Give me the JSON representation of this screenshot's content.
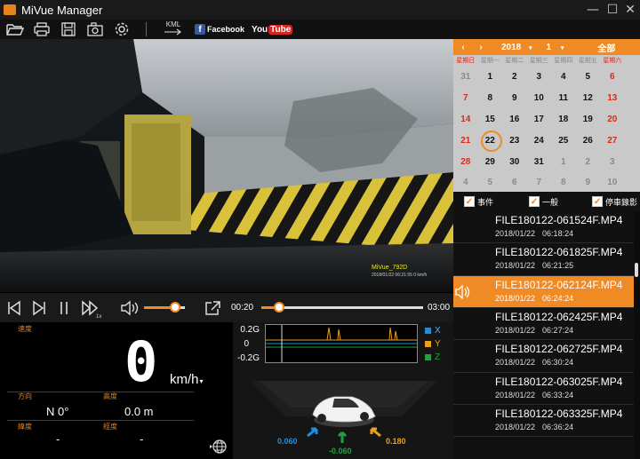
{
  "window": {
    "title": "MiVue Manager"
  },
  "toolbar": {
    "open_icon": "folder-open-icon",
    "print_icon": "printer-icon",
    "save_icon": "save-icon",
    "snapshot_icon": "camera-icon",
    "settings_icon": "gear-icon",
    "kml_label": "KML",
    "facebook_label": "Facebook",
    "facebook_logo": "f",
    "youtube_you": "You",
    "youtube_tube": "Tube"
  },
  "video": {
    "overlay_model": "MiVue_792D",
    "overlay_info": "2018/01/22 06:21:55  0 km/h"
  },
  "playback": {
    "current_time": "00:20",
    "total_time": "03:00",
    "progress": 0.11,
    "volume": 0.75,
    "speed_label": "1x"
  },
  "dashboard": {
    "speed_label": "速度",
    "speed_value": "0",
    "speed_unit": "km/h",
    "direction_label": "方向",
    "direction_value": "N 0°",
    "altitude_label": "高度",
    "altitude_value": "0.0  m",
    "latitude_label": "緯度",
    "latitude_value": "-",
    "longitude_label": "經度",
    "longitude_value": "-"
  },
  "gsensor": {
    "ticks": [
      "0.2G",
      "0",
      "-0.2G"
    ],
    "legend": [
      "X",
      "Y",
      "Z"
    ],
    "colors": {
      "x": "#1e8fe0",
      "y": "#e8a020",
      "z": "#22a040"
    },
    "x_value": "0.060",
    "y_value": "0.180",
    "z_value": "-0.060"
  },
  "calendar": {
    "year": "2018",
    "month": "1",
    "all_label": "全部",
    "weekdays": [
      "星期日",
      "星期一",
      "星期二",
      "星期三",
      "星期四",
      "星期五",
      "星期六"
    ],
    "weeks": [
      [
        "31",
        "1",
        "2",
        "3",
        "4",
        "5",
        "6"
      ],
      [
        "7",
        "8",
        "9",
        "10",
        "11",
        "12",
        "13"
      ],
      [
        "14",
        "15",
        "16",
        "17",
        "18",
        "19",
        "20"
      ],
      [
        "21",
        "22",
        "23",
        "24",
        "25",
        "26",
        "27"
      ],
      [
        "28",
        "29",
        "30",
        "31",
        "1",
        "2",
        "3"
      ],
      [
        "4",
        "5",
        "6",
        "7",
        "8",
        "9",
        "10"
      ]
    ],
    "selected": "22"
  },
  "filters": {
    "event_label": "事件",
    "normal_label": "一般",
    "parking_label": "停車錄影"
  },
  "files": [
    {
      "name": "FILE180122-061524F.MP4",
      "date": "2018/01/22",
      "time": "06:18:24"
    },
    {
      "name": "FILE180122-061825F.MP4",
      "date": "2018/01/22",
      "time": "06:21:25"
    },
    {
      "name": "FILE180122-062124F.MP4",
      "date": "2018/01/22",
      "time": "06:24:24"
    },
    {
      "name": "FILE180122-062425F.MP4",
      "date": "2018/01/22",
      "time": "06:27:24"
    },
    {
      "name": "FILE180122-062725F.MP4",
      "date": "2018/01/22",
      "time": "06:30:24"
    },
    {
      "name": "FILE180122-063025F.MP4",
      "date": "2018/01/22",
      "time": "06:33:24"
    },
    {
      "name": "FILE180122-063325F.MP4",
      "date": "2018/01/22",
      "time": "06:36:24"
    }
  ],
  "active_file_index": 2
}
